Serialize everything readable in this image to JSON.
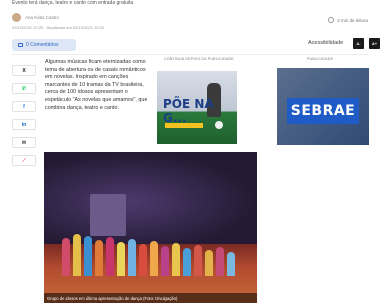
{
  "article": {
    "subtitle": "Evento terá dança, teatro e canto com entrada gratuita",
    "author": "Ana Kátia Castro",
    "dates": "02/10/2021 20:20 · Atualizado em 02/10/2021 20:20",
    "read_time": "2 min de leitura",
    "body": "Algumas músicas ficam eternizadas como tema de abertura ou de casais românticos em novelas. Inspirado em canções marcantes de 10 tramas da TV brasileira, cerca de 100 idosos apresentam o espetáculo \"As novelas que amamos\", que combina dança, teatro e canto."
  },
  "toolbar": {
    "comments_label": "0 Comentários",
    "accessibility_label": "Acessibilidade",
    "font_decrease": "A-",
    "font_increase": "A+"
  },
  "share": [
    {
      "name": "x",
      "glyph": "X",
      "color": "#111111"
    },
    {
      "name": "whatsapp",
      "glyph": "✆",
      "color": "#25d366"
    },
    {
      "name": "facebook",
      "glyph": "f",
      "color": "#1877f2"
    },
    {
      "name": "linkedin",
      "glyph": "in",
      "color": "#0a66c2"
    },
    {
      "name": "email",
      "glyph": "✉",
      "color": "#555555"
    },
    {
      "name": "link",
      "glyph": "⟋",
      "color": "#e0546b"
    }
  ],
  "ads": {
    "label_1": "CONTINUA DEPOIS DA PUBLICIDADE",
    "label_2": "PUBLICIDADE",
    "ad1_text": "PÕE NA G...",
    "ad2_text": "SEBRAE"
  },
  "hero": {
    "caption": "Grupo de idosos em última apresentação de dança (Foto: Divulgação)"
  }
}
